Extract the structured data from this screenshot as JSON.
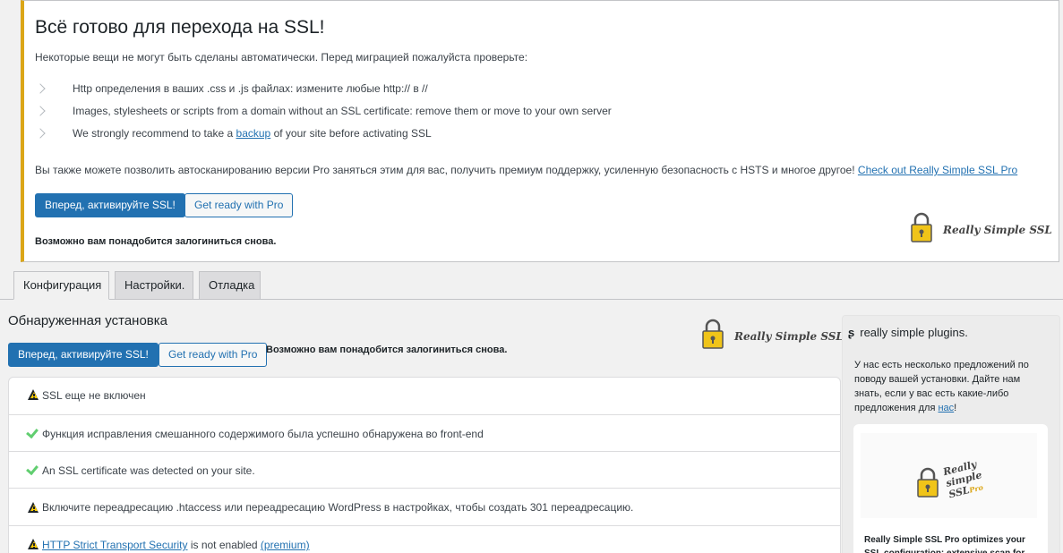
{
  "notice": {
    "title": "Всё готово для перехода на SSL!",
    "intro": "Некоторые вещи не могут быть сделаны автоматически. Перед миграцией пожалуйста проверьте:",
    "items": [
      {
        "text": "Http определения в ваших .css и .js файлах: измените любые http:// в //"
      },
      {
        "text": "Images, stylesheets or scripts from a domain without an SSL certificate: remove them or move to your own server"
      },
      {
        "before": "We strongly recommend to take a ",
        "link": "backup",
        "after": " of your site before activating SSL"
      }
    ],
    "pro_text": "Вы также можете позволить автосканированию версии Pro заняться этим для вас, получить премиум поддержку, усиленную безопасность с HSTS и многое другое! ",
    "pro_link": "Check out Really Simple SSL Pro",
    "activate_button": "Вперед, активируйте SSL!",
    "pro_button": "Get ready with Pro",
    "relogin": "Возможно вам понадобится залогиниться снова.",
    "logo_text": "Really Simple SSL"
  },
  "tabs": [
    {
      "label": "Конфигурация",
      "active": true
    },
    {
      "label": "Настройки.",
      "active": false
    },
    {
      "label": "Отладка",
      "active": false
    }
  ],
  "config": {
    "title": "Обнаруженная установка",
    "activate_button": "Вперед, активируйте SSL!",
    "pro_button": "Get ready with Pro",
    "relogin": "Возможно вам понадобится залогиниться снова.",
    "logo_text": "Really Simple SSL",
    "rows": [
      {
        "status": "warning",
        "text": "SSL еще не включен"
      },
      {
        "status": "success",
        "text": "Функция исправления смешанного содержимого была успешно обнаружена во front-end"
      },
      {
        "status": "success",
        "text": "An SSL certificate was detected on your site."
      },
      {
        "status": "warning",
        "text": "Включите переадресацию .htaccess или переадресацию WordPress в настройках, чтобы создать 301 переадресацию."
      },
      {
        "status": "warning",
        "link": "HTTP Strict Transport Security",
        "middle": " is not enabled ",
        "link2": "(premium)"
      }
    ]
  },
  "sidebar": {
    "logo_glyph": "ʂ",
    "title": "really simple plugins.",
    "text_before": "У нас есть несколько предложений по поводу вашей установки. Дайте нам знать, если у вас есть какие-либо предложения для ",
    "text_link": "нас",
    "text_after": "!",
    "promo_line1": "Really",
    "promo_line2": "simple",
    "promo_line3": "SSL",
    "promo_pro": "Pro",
    "desc": "Really Simple SSL Pro optimizes your SSL configuration: extensive scan for mixed"
  },
  "colors": {
    "accent": "#2271b1",
    "notice_border": "#dba617",
    "warning": "#ffcc00",
    "success": "#61ce70",
    "lock": "#f0c419"
  },
  "icons": [
    "chevron-right-icon",
    "warning-icon",
    "check-icon",
    "padlock-icon",
    "really-simple-plugins-logo-icon"
  ]
}
